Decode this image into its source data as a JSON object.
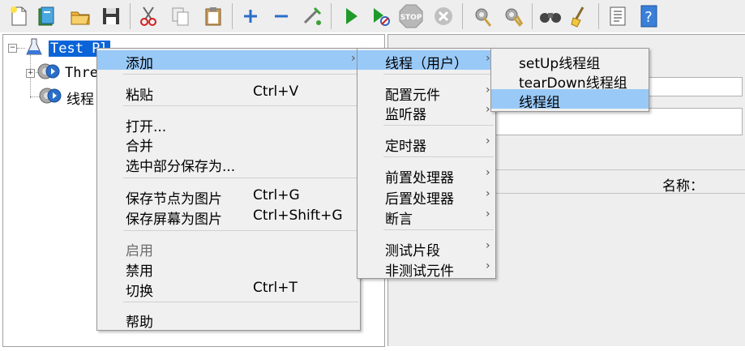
{
  "toolbar": {
    "buttons": [
      {
        "name": "new-icon"
      },
      {
        "name": "templates-icon"
      },
      {
        "name": "open-icon"
      },
      {
        "name": "save-icon"
      },
      {
        "name": "cut-icon"
      },
      {
        "name": "copy-icon"
      },
      {
        "name": "paste-icon"
      },
      {
        "name": "expand-icon"
      },
      {
        "name": "collapse-icon"
      },
      {
        "name": "toggle-icon"
      },
      {
        "name": "start-icon"
      },
      {
        "name": "start-no-pause-icon"
      },
      {
        "name": "stop-icon"
      },
      {
        "name": "shutdown-icon"
      },
      {
        "name": "clear-icon"
      },
      {
        "name": "clear-all-icon"
      },
      {
        "name": "search-icon"
      },
      {
        "name": "reset-search-icon"
      },
      {
        "name": "function-helper-icon"
      },
      {
        "name": "help-icon"
      }
    ],
    "stop_text": "STOP"
  },
  "tree": {
    "root_label": "Test Pl",
    "child1_label": "Thre",
    "child2_label": "线程"
  },
  "right_panel": {
    "name_label": "名称："
  },
  "context_menu": {
    "add": "添加",
    "paste": "粘贴",
    "paste_shortcut": "Ctrl+V",
    "open": "打开...",
    "merge": "合并",
    "save_selection_as": "选中部分保存为...",
    "save_node_as_image": "保存节点为图片",
    "save_node_as_image_shortcut": "Ctrl+G",
    "save_screen_as_image": "保存屏幕为图片",
    "save_screen_as_image_shortcut": "Ctrl+Shift+G",
    "enable": "启用",
    "disable": "禁用",
    "toggle": "切换",
    "toggle_shortcut": "Ctrl+T",
    "help": "帮助"
  },
  "add_submenu": {
    "threads": "线程（用户）",
    "config_element": "配置元件",
    "listener": "监听器",
    "timer": "定时器",
    "pre_processor": "前置处理器",
    "post_processor": "后置处理器",
    "assertion": "断言",
    "test_fragment": "测试片段",
    "non_test_elements": "非测试元件"
  },
  "threads_submenu": {
    "setup_thread_group": "setUp线程组",
    "teardown_thread_group": "tearDown线程组",
    "thread_group": "线程组"
  },
  "colors": {
    "selection": "#99c9f7",
    "tree_selection": "#0a64d8",
    "menu_bg": "#f0f0f0",
    "toolbar_bg": "#eeeeee"
  }
}
